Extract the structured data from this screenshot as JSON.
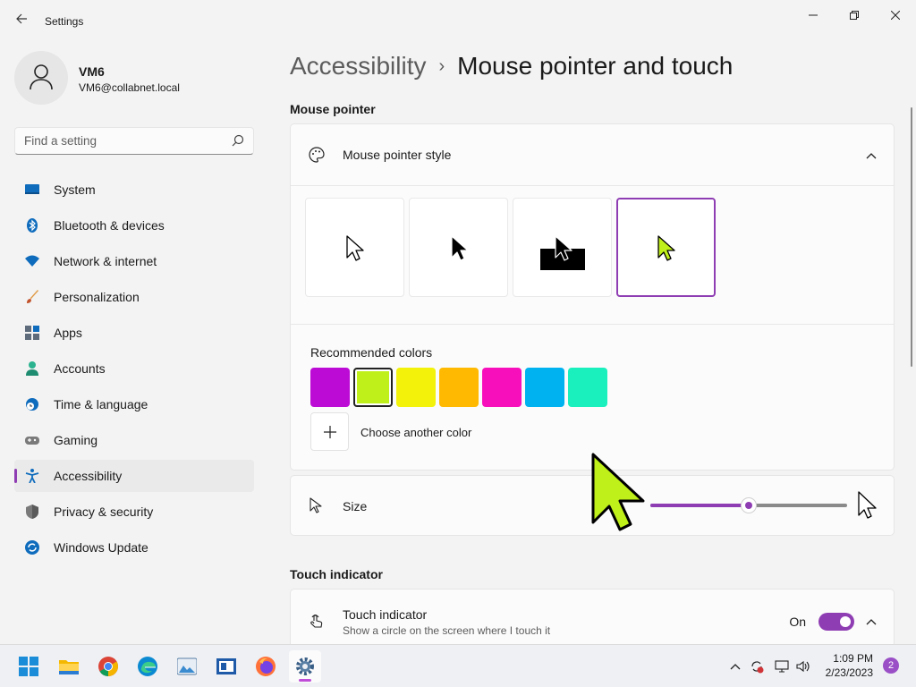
{
  "window": {
    "title": "Settings",
    "back_icon": "arrow-left-icon",
    "controls": [
      "minimize-icon",
      "restore-icon",
      "close-icon"
    ]
  },
  "profile": {
    "name": "VM6",
    "email": "VM6@collabnet.local"
  },
  "search": {
    "placeholder": "Find a setting"
  },
  "sidebar": {
    "items": [
      {
        "label": "System",
        "icon": "monitor-icon",
        "color": "#0f6cbd"
      },
      {
        "label": "Bluetooth & devices",
        "icon": "bluetooth-icon",
        "color": "#0f6cbd"
      },
      {
        "label": "Network & internet",
        "icon": "wifi-icon",
        "color": "#0f6cbd"
      },
      {
        "label": "Personalization",
        "icon": "brush-icon",
        "color": "#d1793a"
      },
      {
        "label": "Apps",
        "icon": "apps-icon",
        "color": "#5d6b7a"
      },
      {
        "label": "Accounts",
        "icon": "person-icon",
        "color": "#2bb38f"
      },
      {
        "label": "Time & language",
        "icon": "globe-clock-icon",
        "color": "#0f6cbd"
      },
      {
        "label": "Gaming",
        "icon": "gamepad-icon",
        "color": "#6b6b6b"
      },
      {
        "label": "Accessibility",
        "icon": "accessibility-icon",
        "color": "#0f6cbd",
        "selected": true
      },
      {
        "label": "Privacy & security",
        "icon": "shield-icon",
        "color": "#6b6b6b"
      },
      {
        "label": "Windows Update",
        "icon": "update-icon",
        "color": "#0f6cbd"
      }
    ],
    "accent": "#8f3db3"
  },
  "breadcrumb": {
    "parent": "Accessibility",
    "separator": "›",
    "current": "Mouse pointer and touch"
  },
  "mouse_pointer": {
    "section_title": "Mouse pointer",
    "style_label": "Mouse pointer style",
    "style_options": [
      "white-pointer",
      "black-pointer",
      "inverted-pointer",
      "custom-color-pointer"
    ],
    "selected_style": 3,
    "recommended_colors_label": "Recommended colors",
    "colors": [
      "#bd0bd6",
      "#c0f01a",
      "#f2f20a",
      "#ffb900",
      "#f70fbb",
      "#00b3f0",
      "#19f0bd"
    ],
    "selected_color": 1,
    "choose_color_label": "Choose another color",
    "size_label": "Size",
    "size_value": 0.5
  },
  "touch_indicator": {
    "section_title": "Touch indicator",
    "label": "Touch indicator",
    "description": "Show a circle on the screen where I touch it",
    "state_text": "On",
    "enabled": true
  },
  "taskbar": {
    "apps": [
      "start-icon",
      "file-explorer-icon",
      "chrome-icon",
      "edge-icon",
      "photos-icon",
      "news-icon",
      "firefox-icon",
      "settings-icon"
    ],
    "time": "1:09 PM",
    "date": "2/23/2023",
    "notification_count": "2"
  }
}
